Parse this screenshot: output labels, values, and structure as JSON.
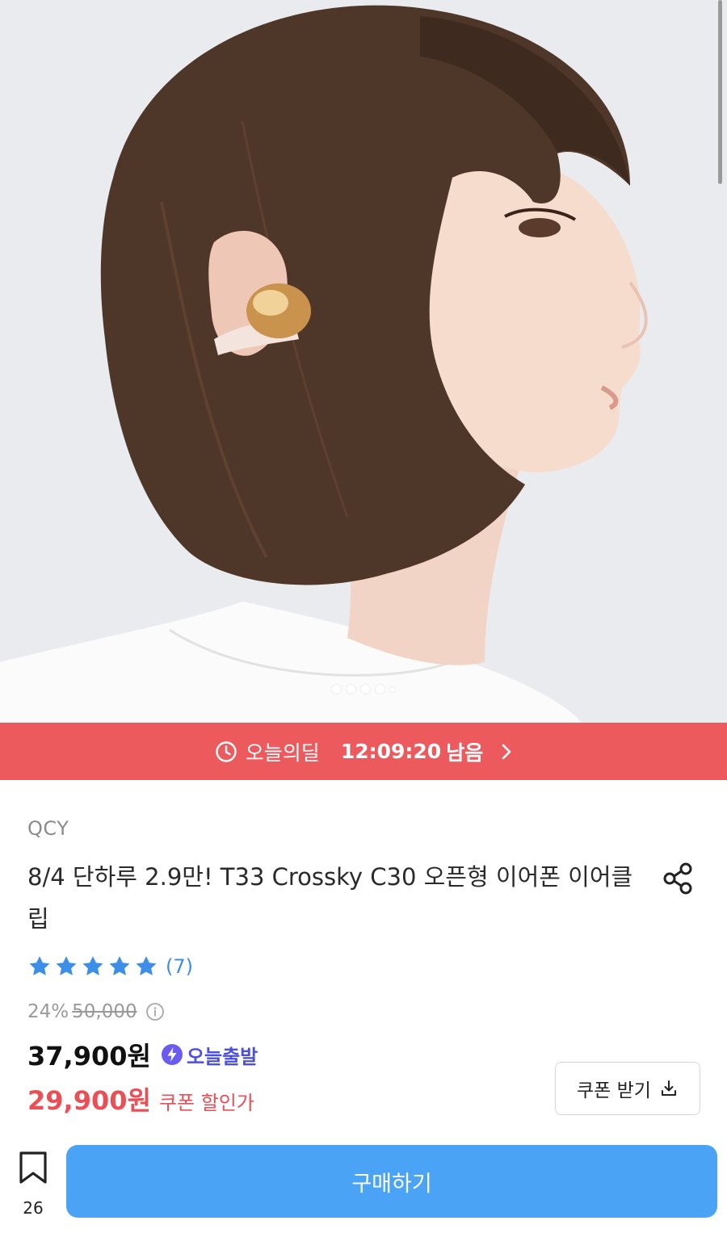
{
  "hero": {
    "image_description": "",
    "dots_count": 5,
    "active_dot": 0
  },
  "deal_bar": {
    "label": "오늘의딜",
    "time": "12:09:20",
    "remain": "남음",
    "clock_icon": "clock-icon",
    "chevron_icon": "chevron-right-icon",
    "bg_color": "#ec5a5e"
  },
  "product": {
    "brand": "QCY",
    "title": "8/4 단하루 2.9만! T33 Crossky C30 오픈형 이어폰 이어클립",
    "share_icon": "share-icon",
    "rating": {
      "stars": 5,
      "max": 5,
      "count": "(7)"
    },
    "discount_rate": "24%",
    "original_price": "50,000",
    "price": "37,900원",
    "shipping_badge": "오늘출발",
    "coupon_price": "29,900원",
    "coupon_label": "쿠폰 할인가",
    "coupon_button": "쿠폰 받기"
  },
  "bottom": {
    "bookmark_count": "26",
    "buy_label": "구매하기",
    "accent": "#4aa3f5"
  }
}
